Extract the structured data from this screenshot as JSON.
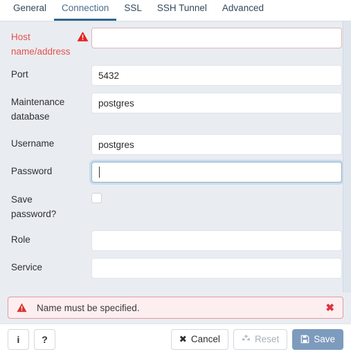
{
  "tabs": [
    {
      "label": "General",
      "active": false
    },
    {
      "label": "Connection",
      "active": true
    },
    {
      "label": "SSL",
      "active": false
    },
    {
      "label": "SSH Tunnel",
      "active": false
    },
    {
      "label": "Advanced",
      "active": false
    }
  ],
  "fields": {
    "host": {
      "label": "Host name/address",
      "value": "",
      "placeholder": ""
    },
    "port": {
      "label": "Port",
      "value": "5432",
      "placeholder": ""
    },
    "maintdb": {
      "label": "Maintenance database",
      "value": "postgres",
      "placeholder": ""
    },
    "username": {
      "label": "Username",
      "value": "postgres",
      "placeholder": ""
    },
    "password": {
      "label": "Password",
      "value": "",
      "placeholder": ""
    },
    "savepw": {
      "label": "Save password?",
      "checked": false
    },
    "role": {
      "label": "Role",
      "value": "",
      "placeholder": ""
    },
    "service": {
      "label": "Service",
      "value": "",
      "placeholder": ""
    }
  },
  "alert": {
    "message": "Name must be specified.",
    "icon": "warning-triangle-icon",
    "close_label": "✖"
  },
  "footer": {
    "info_label": "i",
    "help_label": "?",
    "cancel_label": "Cancel",
    "cancel_icon": "✖",
    "reset_label": "Reset",
    "save_label": "Save"
  },
  "colors": {
    "accent": "#31668e",
    "danger": "#e8504a",
    "alert_bg": "#fdeeef",
    "alert_border": "#e09ba2",
    "save_bg": "#7d9bbd",
    "form_bg": "#e9edf2"
  }
}
